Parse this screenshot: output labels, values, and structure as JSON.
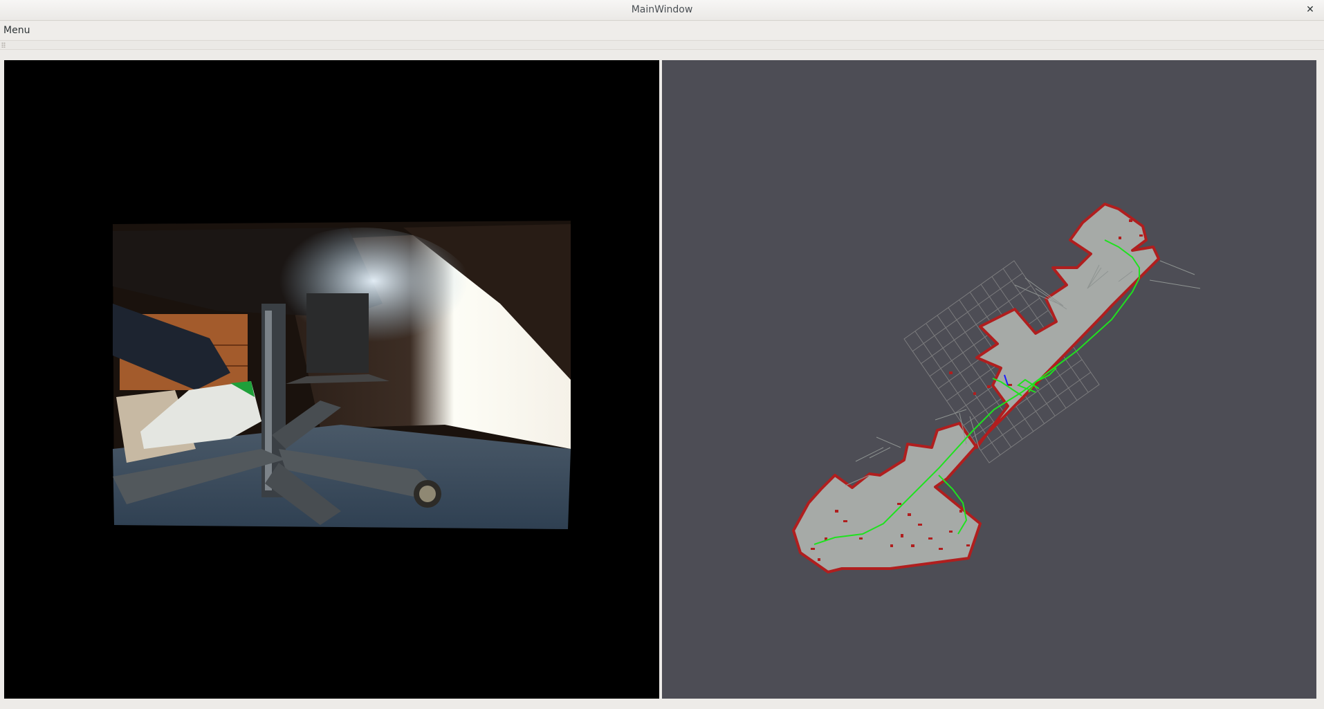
{
  "window": {
    "title": "MainWindow",
    "close_glyph": "✕"
  },
  "menubar": {
    "items": [
      {
        "label": "Menu"
      }
    ]
  },
  "panels": {
    "camera": {
      "icon": "camera-feed-image"
    },
    "map": {
      "icon": "occupancy-grid-map",
      "colors": {
        "background": "#4d4d55",
        "free_space": "#a7aba8",
        "walls": "#b01e1e",
        "path": "#1fe21f",
        "grid": "#8a8a8a",
        "pose": "#1a1aff"
      }
    }
  }
}
